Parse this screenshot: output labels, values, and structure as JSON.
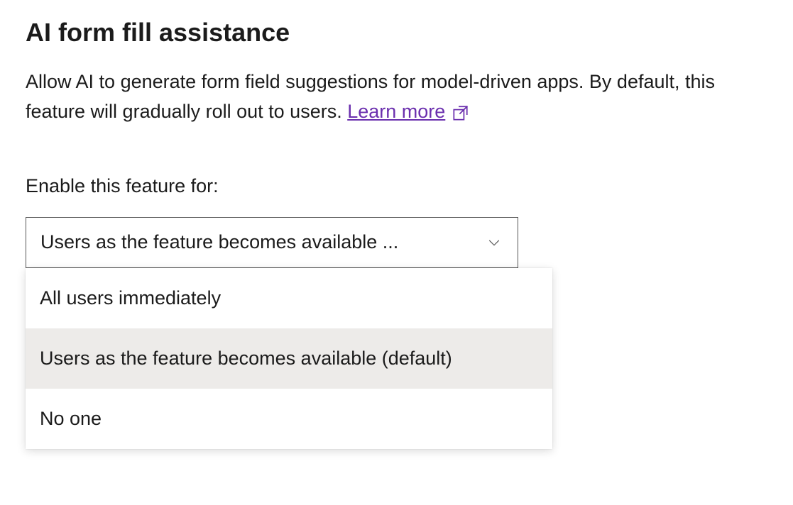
{
  "section": {
    "title": "AI form fill assistance",
    "description_part1": "Allow AI to generate form field suggestions for model-driven apps. By default, this feature will gradually roll out to users. ",
    "learn_more_label": "Learn more"
  },
  "field": {
    "label": "Enable this feature for:",
    "selected_value": "Users as the feature becomes available ..."
  },
  "options": [
    {
      "label": "All users immediately",
      "highlighted": false
    },
    {
      "label": "Users as the feature becomes available (default)",
      "highlighted": true
    },
    {
      "label": "No one",
      "highlighted": false
    }
  ]
}
